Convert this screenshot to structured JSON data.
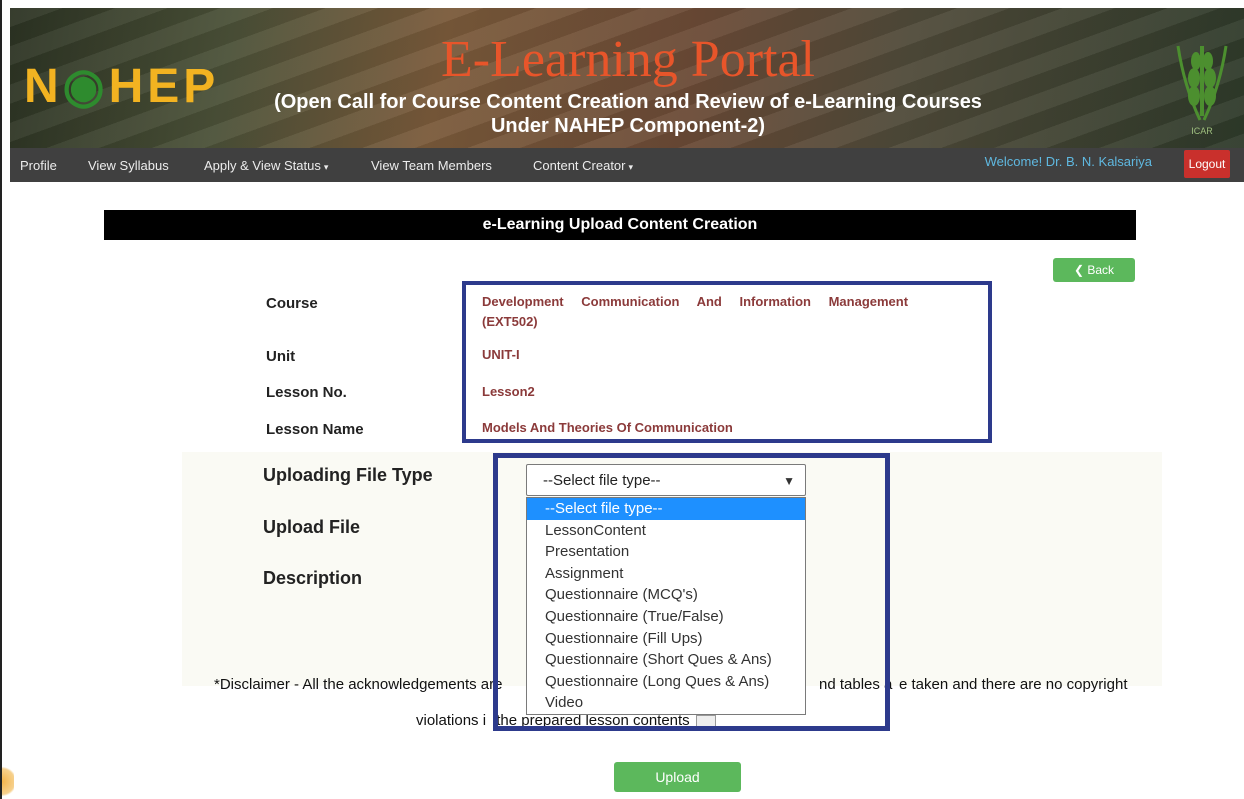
{
  "header": {
    "logo_text_1": "N",
    "logo_text_2": "H",
    "logo_text_3": "EP",
    "title": "E-Learning Portal",
    "subtitle_line1": "(Open Call for Course Content Creation and Review of e-Learning Courses",
    "subtitle_line2": "Under NAHEP Component-2)",
    "right_logo_caption": "ICAR"
  },
  "nav": {
    "items": [
      "Profile",
      "View Syllabus",
      "Apply & View Status",
      "View Team Members",
      "Content Creator"
    ],
    "welcome": "Welcome! Dr. B. N. Kalsariya",
    "logout": "Logout"
  },
  "page": {
    "section_title": "e-Learning Upload Content Creation",
    "back_label": "Back"
  },
  "details": {
    "course_label": "Course",
    "course_value": "Development Communication And Information Management (EXT502)",
    "unit_label": "Unit",
    "unit_value": "UNIT-I",
    "lesson_no_label": "Lesson No.",
    "lesson_no_value": "Lesson2",
    "lesson_name_label": "Lesson Name",
    "lesson_name_value": "Models And Theories Of Communication"
  },
  "form": {
    "file_type_label": "Uploading File Type",
    "upload_file_label": "Upload File",
    "description_label": "Description",
    "select_value": "--Select file type--",
    "options": [
      "--Select file type--",
      "LessonContent",
      "Presentation",
      "Assignment",
      "Questionnaire (MCQ's)",
      "Questionnaire (True/False)",
      "Questionnaire (Fill Ups)",
      "Questionnaire (Short Ques & Ans)",
      "Questionnaire (Long Ques & Ans)",
      "Video"
    ],
    "disclaimer_line1_a": "*Disclaimer - All the acknowledgements are",
    "disclaimer_line1_b": "nd tables a",
    "disclaimer_line1_c": "e taken and there are no copyright",
    "disclaimer_line2_a": "violations i",
    "disclaimer_line2_b": "the prepared lesson contents",
    "upload_label": "Upload"
  }
}
